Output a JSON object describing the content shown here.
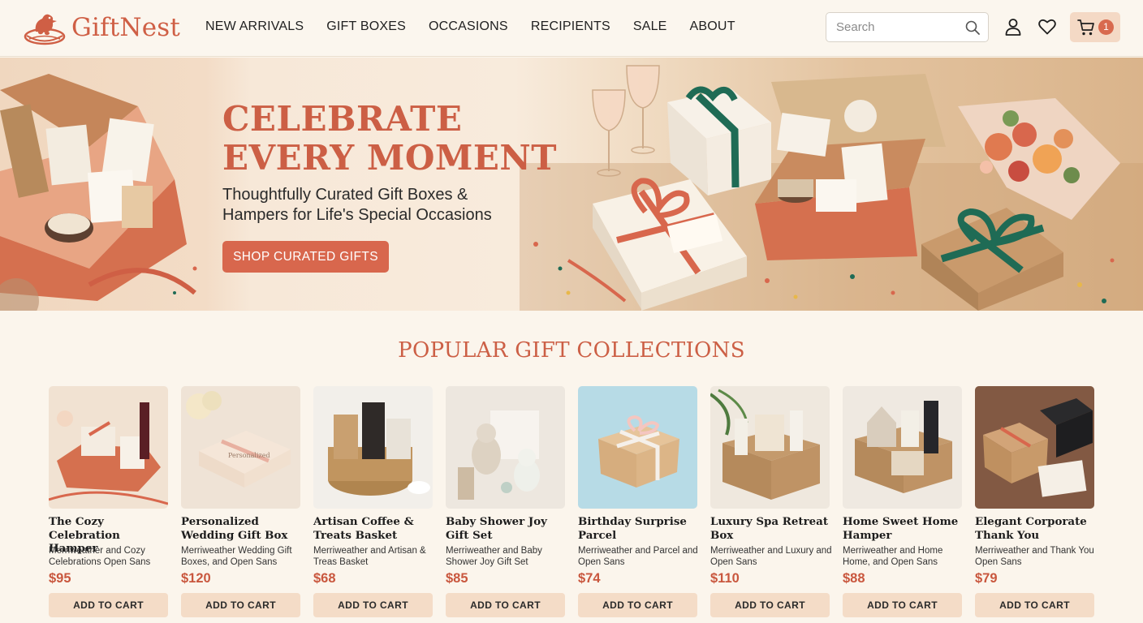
{
  "header": {
    "brand": "GiftNest",
    "nav": [
      "NEW ARRIVALS",
      "GIFT BOXES",
      "OCCASIONS",
      "RECIPIENTS",
      "SALE",
      "ABOUT"
    ],
    "search_placeholder": "Search",
    "cart_count": "1"
  },
  "hero": {
    "title_line1": "CELEBRATE",
    "title_line2": "EVERY MOMENT",
    "subtitle": "Thoughtfully Curated Gift Boxes & Hampers for Life's Special Occasions",
    "cta": "SHOP CURATED GIFTS"
  },
  "section_title": "POPULAR GIFT COLLECTIONS",
  "products": [
    {
      "name": "The Cozy Celebration Hamper",
      "desc": "Merriweather and Cozy Celebrations Open Sans",
      "price": "$95",
      "cta": "ADD TO CART"
    },
    {
      "name": "Personalized Wedding Gift Box",
      "desc": "Merriweather Wedding Gift Boxes, and Open Sans",
      "price": "$120",
      "cta": "ADD TO CART"
    },
    {
      "name": "Artisan Coffee & Treats Basket",
      "desc": "Merriweather and Artisan & Treas Basket",
      "price": "$68",
      "cta": "ADD TO CART"
    },
    {
      "name": "Baby Shower Joy Gift Set",
      "desc": "Merriweather and Baby Shower Joy Gift Set",
      "price": "$85",
      "cta": "ADD TO CART"
    },
    {
      "name": "Birthday Surprise Parcel",
      "desc": "Merriweather and Parcel and Open Sans",
      "price": "$74",
      "cta": "ADD TO CART"
    },
    {
      "name": "Luxury Spa Retreat Box",
      "desc": "Merriweather and Luxury and Open Sans",
      "price": "$110",
      "cta": "ADD TO CART"
    },
    {
      "name": "Home Sweet Home Hamper",
      "desc": "Merriweather and Home Home, and Open Sans",
      "price": "$88",
      "cta": "ADD TO CART"
    },
    {
      "name": "Elegant Corporate Thank You",
      "desc": "Merriweather and Thank You Open Sans",
      "price": "$79",
      "cta": "ADD TO CART"
    }
  ],
  "colors": {
    "accent": "#cc5f45",
    "button": "#d8674d",
    "cart_bg": "#f4d9c5",
    "page_bg": "#fbf5ec"
  }
}
